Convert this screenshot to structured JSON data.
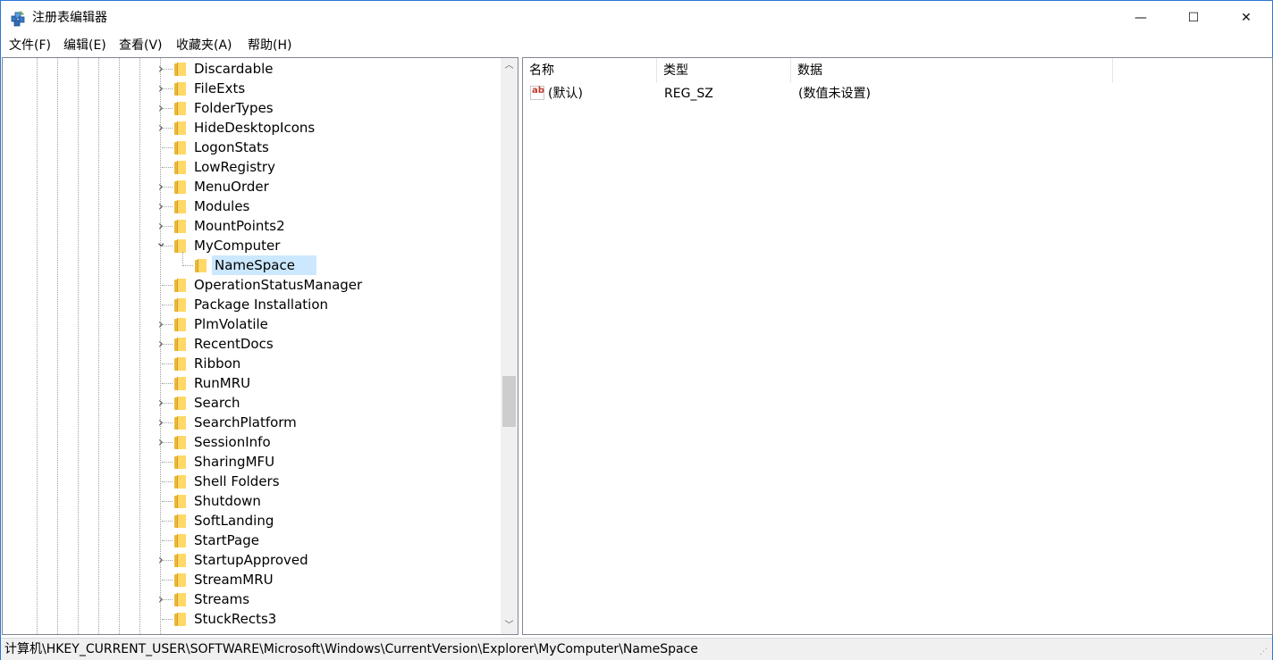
{
  "window": {
    "title": "注册表编辑器"
  },
  "window_controls": {
    "minimize": "—",
    "maximize": "☐",
    "close": "✕"
  },
  "menu": [
    "文件(F)",
    "编辑(E)",
    "查看(V)",
    "收藏夹(A)",
    "帮助(H)"
  ],
  "tree": {
    "items": [
      {
        "label": "Discardable",
        "expander": "collapsed",
        "selected": false
      },
      {
        "label": "FileExts",
        "expander": "collapsed",
        "selected": false
      },
      {
        "label": "FolderTypes",
        "expander": "collapsed",
        "selected": false
      },
      {
        "label": "HideDesktopIcons",
        "expander": "collapsed",
        "selected": false
      },
      {
        "label": "LogonStats",
        "expander": "none",
        "selected": false
      },
      {
        "label": "LowRegistry",
        "expander": "none",
        "selected": false
      },
      {
        "label": "MenuOrder",
        "expander": "collapsed",
        "selected": false
      },
      {
        "label": "Modules",
        "expander": "collapsed",
        "selected": false
      },
      {
        "label": "MountPoints2",
        "expander": "collapsed",
        "selected": false
      },
      {
        "label": "MyComputer",
        "expander": "expanded",
        "selected": false
      },
      {
        "label": "NameSpace",
        "expander": "child",
        "selected": true
      },
      {
        "label": "OperationStatusManager",
        "expander": "none",
        "selected": false
      },
      {
        "label": "Package Installation",
        "expander": "none",
        "selected": false
      },
      {
        "label": "PlmVolatile",
        "expander": "collapsed",
        "selected": false
      },
      {
        "label": "RecentDocs",
        "expander": "collapsed",
        "selected": false
      },
      {
        "label": "Ribbon",
        "expander": "none",
        "selected": false
      },
      {
        "label": "RunMRU",
        "expander": "none",
        "selected": false
      },
      {
        "label": "Search",
        "expander": "collapsed",
        "selected": false
      },
      {
        "label": "SearchPlatform",
        "expander": "collapsed",
        "selected": false
      },
      {
        "label": "SessionInfo",
        "expander": "collapsed",
        "selected": false
      },
      {
        "label": "SharingMFU",
        "expander": "none",
        "selected": false
      },
      {
        "label": "Shell Folders",
        "expander": "none",
        "selected": false
      },
      {
        "label": "Shutdown",
        "expander": "none",
        "selected": false
      },
      {
        "label": "SoftLanding",
        "expander": "none",
        "selected": false
      },
      {
        "label": "StartPage",
        "expander": "none",
        "selected": false
      },
      {
        "label": "StartupApproved",
        "expander": "collapsed",
        "selected": false
      },
      {
        "label": "StreamMRU",
        "expander": "none",
        "selected": false
      },
      {
        "label": "Streams",
        "expander": "collapsed",
        "selected": false
      },
      {
        "label": "StuckRects3",
        "expander": "none",
        "selected": false
      }
    ]
  },
  "values_list": {
    "columns": [
      "名称",
      "类型",
      "数据"
    ],
    "rows": [
      {
        "name": "(默认)",
        "type": "REG_SZ",
        "data": "(数值未设置)",
        "icon": "ab"
      }
    ]
  },
  "statusbar": {
    "path": "计算机\\HKEY_CURRENT_USER\\SOFTWARE\\Microsoft\\Windows\\CurrentVersion\\Explorer\\MyComputer\\NameSpace"
  }
}
